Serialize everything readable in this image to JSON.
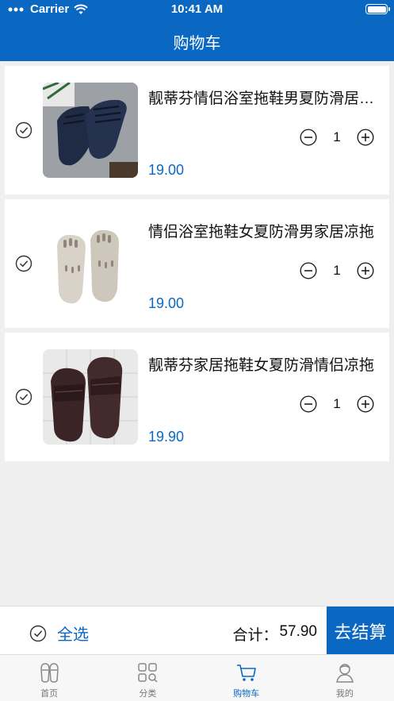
{
  "status_bar": {
    "carrier": "Carrier",
    "time": "10:41 AM"
  },
  "nav": {
    "title": "购物车"
  },
  "cart": {
    "items": [
      {
        "name": "靓蒂芬情侣浴室拖鞋男夏防滑居家凉拖",
        "price": "19.00",
        "quantity": "1",
        "image_icon": "dark-navy-slipper-image"
      },
      {
        "name": "情侣浴室拖鞋女夏防滑男家居凉拖",
        "price": "19.00",
        "quantity": "1",
        "image_icon": "beige-slipper-image"
      },
      {
        "name": "靓蒂芬家居拖鞋女夏防滑情侣凉拖",
        "price": "19.90",
        "quantity": "1",
        "image_icon": "brown-slipper-image"
      }
    ]
  },
  "footer": {
    "select_all": "全选",
    "total_label": "合计：",
    "total_value": "57.90",
    "checkout": "去结算"
  },
  "tabs": [
    {
      "label": "首页",
      "icon": "slippers-icon",
      "active": false
    },
    {
      "label": "分类",
      "icon": "category-grid-icon",
      "active": false
    },
    {
      "label": "购物车",
      "icon": "cart-icon",
      "active": true
    },
    {
      "label": "我的",
      "icon": "profile-icon",
      "active": false
    }
  ],
  "colors": {
    "brand": "#0a68c2",
    "background": "#efefef"
  }
}
